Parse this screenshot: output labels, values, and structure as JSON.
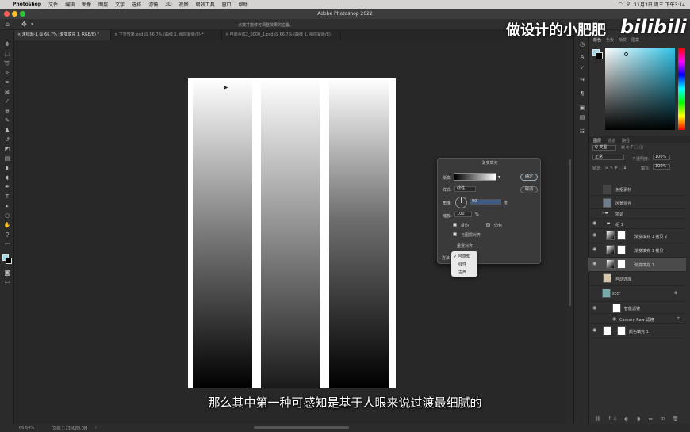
{
  "menubar": {
    "app": "Photoshop",
    "items": [
      "文件",
      "编辑",
      "图像",
      "图层",
      "文字",
      "选择",
      "滤镜",
      "3D",
      "视图",
      "增效工具",
      "窗口",
      "帮助"
    ],
    "datetime": "11月3日 周三 下午3:14"
  },
  "window": {
    "title": "Adobe Photoshop 2022"
  },
  "options": {
    "hint": "点按并拖移可调整效果的位置。"
  },
  "tabs": [
    {
      "label": "未标题-1 @ 66.7% (渐变填充 1, RGB/8) *"
    },
    {
      "label": "下雪效果.psd @ 66.7% (曲线 1, 图层蒙版/8) *"
    },
    {
      "label": "电商合成2_0000_1.psd @ 66.7% (曲线 1, 图层蒙版/8)"
    }
  ],
  "status": {
    "zoom": "66.64%",
    "doc": "文档:7.23M/89.0M"
  },
  "panels": {
    "color_tabs": [
      "颜色",
      "色板",
      "渐变",
      "图案"
    ],
    "layer_tabs": [
      "图层",
      "通道",
      "路径"
    ],
    "kind": "Q 类型",
    "mode": "正常",
    "opacity_label": "不透明度:",
    "opacity": "100%",
    "lock_label": "锁定:",
    "fill_label": "填充:",
    "fill": "100%"
  },
  "layers": [
    {
      "name": "免抠素材"
    },
    {
      "name": "风景混合"
    },
    {
      "name": "协调"
    },
    {
      "name": "组 1"
    },
    {
      "name": "渐变填充 1 拷贝 2"
    },
    {
      "name": "渐变填充 1 拷贝"
    },
    {
      "name": "渐变填充 1"
    },
    {
      "name": "自动选择"
    },
    {
      "name": "sccr"
    },
    {
      "name": "智能滤镜"
    },
    {
      "name": "Camera Raw 滤镜"
    },
    {
      "name": "颜色填充 1"
    }
  ],
  "dialog": {
    "title": "渐变填充",
    "gradient_label": "渐变:",
    "style_label": "样式:",
    "style_value": "线性",
    "angle_label": "角度:",
    "angle_value": "90",
    "angle_unit": "度",
    "scale_label": "缩放:",
    "scale_value": "100",
    "scale_unit": "%",
    "reverse_label": "反向",
    "dither_label": "仿色",
    "align_label": "与图层对齐",
    "reset_label": "重置对齐",
    "method_label": "方法:",
    "ok": "确定",
    "cancel": "取消",
    "method_options": [
      "✓ 可感知",
      "线性",
      "古典"
    ]
  },
  "subtitle": "那么其中第一种可感知是基于人眼来说过渡最细腻的",
  "watermark": {
    "text": "做设计的小肥肥",
    "logo": "bilibili"
  }
}
